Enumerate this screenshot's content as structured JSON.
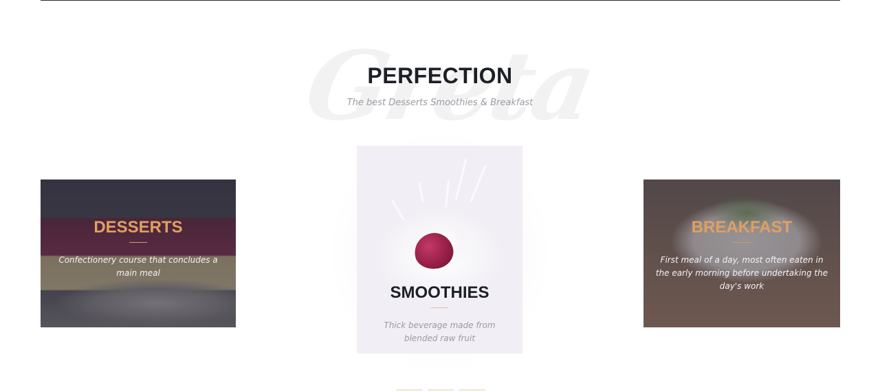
{
  "section": {
    "watermark": "Greta",
    "title": "PERFECTION",
    "subtitle": "The best Desserts Smoothies & Breakfast"
  },
  "cards": [
    {
      "title": "DESSERTS",
      "text": "Confectionery course that concludes a main meal"
    },
    {
      "title": "SMOOTHIES",
      "text": "Thick beverage made from blended raw fruit"
    },
    {
      "title": "BREAKFAST",
      "text": "First meal of a day, most often eaten in the early morning before undertaking the day's work"
    }
  ],
  "colors": {
    "accent": "#e0a062",
    "title": "#1d1f27",
    "muted": "#9a9aa3"
  }
}
